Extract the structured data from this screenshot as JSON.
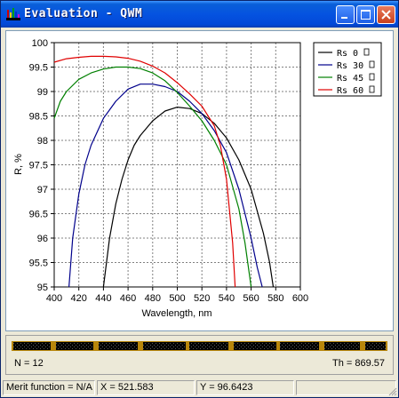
{
  "window": {
    "title": "Evaluation - QWM",
    "icon": "bar-chart-app-icon",
    "buttons": [
      "minimize-icon",
      "maximize-icon",
      "close-icon"
    ]
  },
  "chart_data": {
    "type": "line",
    "title": "",
    "xlabel": "Wavelength, nm",
    "ylabel": "R, %",
    "xlim": [
      400,
      600
    ],
    "ylim": [
      95,
      100
    ],
    "xticks": [
      400,
      420,
      440,
      460,
      480,
      500,
      520,
      540,
      560,
      580,
      600
    ],
    "yticks": [
      95,
      95.5,
      96,
      96.5,
      97,
      97.5,
      98,
      98.5,
      99,
      99.5,
      100
    ],
    "grid": true,
    "legend_position": "top-right",
    "series": [
      {
        "name": "Rs  0",
        "color": "#000000",
        "x": [
          440,
          445,
          450,
          455,
          460,
          465,
          470,
          480,
          490,
          500,
          510,
          520,
          530,
          540,
          550,
          560,
          570,
          575,
          578
        ],
        "y": [
          95,
          96.0,
          96.7,
          97.2,
          97.6,
          97.9,
          98.1,
          98.4,
          98.6,
          98.68,
          98.65,
          98.55,
          98.35,
          98.05,
          97.6,
          97.0,
          96.1,
          95.5,
          95
        ]
      },
      {
        "name": "Rs  30",
        "color": "#00008B",
        "x": [
          412,
          415,
          420,
          425,
          430,
          440,
          450,
          460,
          470,
          480,
          490,
          500,
          510,
          520,
          530,
          540,
          550,
          560,
          565,
          569
        ],
        "y": [
          95,
          96.0,
          96.9,
          97.5,
          97.9,
          98.45,
          98.8,
          99.05,
          99.15,
          99.15,
          99.1,
          99.0,
          98.8,
          98.55,
          98.2,
          97.75,
          97.0,
          96.0,
          95.4,
          95
        ]
      },
      {
        "name": "Rs  45",
        "color": "#008000",
        "x": [
          400,
          405,
          410,
          420,
          430,
          440,
          450,
          460,
          470,
          480,
          490,
          500,
          510,
          520,
          530,
          540,
          550,
          555,
          560
        ],
        "y": [
          98.45,
          98.8,
          99.0,
          99.25,
          99.38,
          99.46,
          99.5,
          99.5,
          99.47,
          99.38,
          99.22,
          98.98,
          98.7,
          98.4,
          98.0,
          97.5,
          96.6,
          95.9,
          95
        ]
      },
      {
        "name": "Rs  60",
        "color": "#E00000",
        "x": [
          400,
          410,
          420,
          430,
          440,
          450,
          460,
          470,
          480,
          490,
          500,
          510,
          520,
          530,
          535,
          540,
          545,
          547
        ],
        "y": [
          99.6,
          99.67,
          99.7,
          99.72,
          99.72,
          99.71,
          99.68,
          99.62,
          99.52,
          99.38,
          99.18,
          98.95,
          98.7,
          98.3,
          97.9,
          97.2,
          95.9,
          95
        ]
      }
    ]
  },
  "progress": {
    "N_label": "N = 12",
    "Th_label": "Th = 869.57"
  },
  "status": {
    "merit": "Merit function = N/A",
    "x": "X = 521.583",
    "y": "Y = 96.6423"
  }
}
